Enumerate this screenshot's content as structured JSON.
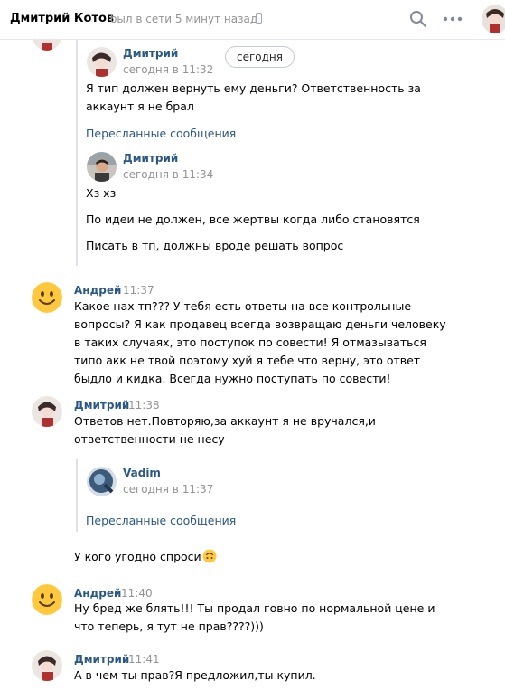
{
  "header": {
    "name": "Дмитрий Котов",
    "status": "был в сети 5 минут назад"
  },
  "today_pill": "сегодня",
  "forward": {
    "msg1": {
      "author": "Дмитрий",
      "time": "сегодня в 11:32",
      "text": "Я тип должен вернуть ему деньги? Ответственность за аккаунт я не брал"
    },
    "link1": "Пересланные сообщения",
    "msg2": {
      "author": "Дмитрий",
      "time": "сегодня в 11:34",
      "lines": [
        "Хз хз",
        "По идеи не должен, все жертвы когда либо становятся",
        "Писать в тп, должны вроде решать вопрос"
      ]
    }
  },
  "messages": {
    "m1": {
      "author": "Андрей",
      "time": "11:37",
      "text": "Какое нах тп??? У тебя есть ответы на все контрольные вопросы? Я как продавец всегда возвращаю деньги человеку в таких случаях, это поступок по совести! Я отмазываться типо акк не твой поэтому хуй я тебе что верну, это ответ быдло и кидка. Всегда нужно поступать по совести!"
    },
    "m2": {
      "author": "Дмитрий",
      "time": "11:38",
      "text": "Ответов нет.Повторяю,за аккаунт я не вручался,и ответственности не несу",
      "fwd_author": "Vadim",
      "fwd_time": "сегодня в 11:37",
      "fwd_link": "Пересланные сообщения",
      "followup": "У кого угодно спроси"
    },
    "m3": {
      "author": "Андрей",
      "time": "11:40",
      "text": "Ну бред же блять!!! Ты продал говно по нормальной цене и что теперь, я тут не прав????)))"
    },
    "m4": {
      "author": "Дмитрий",
      "time": "11:41",
      "text": "А в чем ты прав?Я предложил,ты купил."
    }
  },
  "colors": {
    "link": "#2a5885",
    "muted": "#939393",
    "bar": "#dee1e6",
    "emoji": "#ffc83d"
  }
}
